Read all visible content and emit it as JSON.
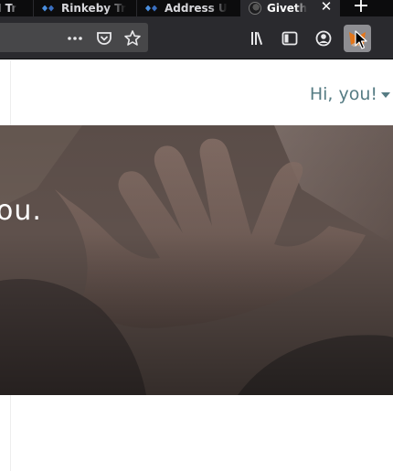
{
  "browser": {
    "tabs": [
      {
        "label": "I Tr",
        "icon": "ethereum-icon"
      },
      {
        "label": "Rinkeby Tr",
        "icon": "ethereum-icon"
      },
      {
        "label": "Address U",
        "icon": "ethereum-icon"
      },
      {
        "label": "Giveth",
        "icon": "giveth-icon",
        "active": true
      }
    ],
    "close_glyph": "✕",
    "new_tab_glyph": "+",
    "toolbar_icons": [
      "page-actions-menu-icon",
      "save-to-pocket-icon",
      "bookmark-star-icon",
      "library-icon",
      "reader-view-icon",
      "account-icon",
      "metamask-extension-icon"
    ]
  },
  "page": {
    "greeting": "Hi, you!",
    "hero_text": "ou."
  },
  "colors": {
    "tabstrip_bg": "#0c0c0d",
    "toolbar_bg": "#2a2a2e",
    "greeting_text": "#567c84",
    "metamask_orange": "#f6851b"
  }
}
